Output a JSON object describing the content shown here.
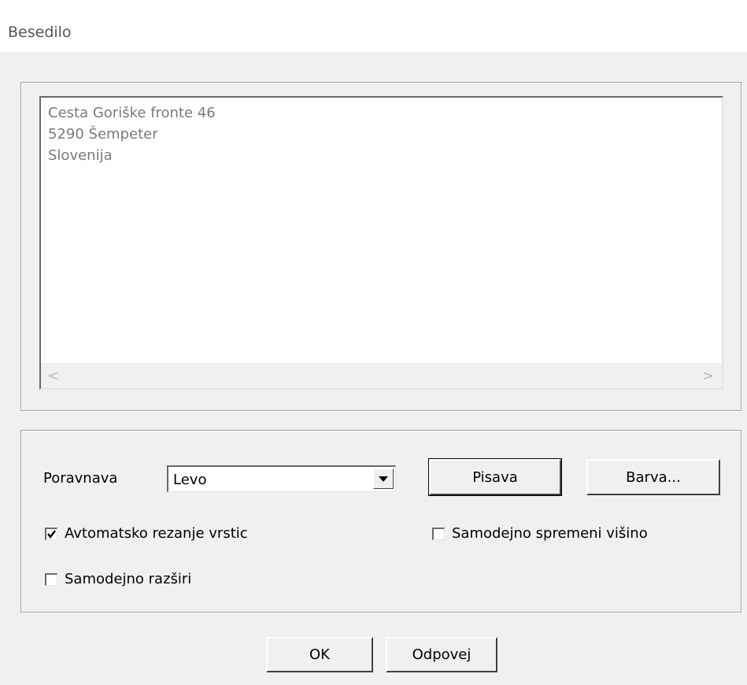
{
  "window": {
    "title": "Besedilo"
  },
  "text_area": {
    "lines": [
      "Cesta Goriške fronte 46",
      "5290 Šempeter",
      "Slovenija"
    ],
    "scroll_left": "<",
    "scroll_right": ">"
  },
  "options": {
    "alignment_label": "Poravnava",
    "alignment_value": "Levo",
    "font_button": "Pisava",
    "color_button": "Barva...",
    "auto_wrap": {
      "label": "Avtomatsko rezanje vrstic",
      "checked": true
    },
    "auto_height": {
      "label": "Samodejno spremeni višino",
      "checked": false
    },
    "auto_expand": {
      "label": "Samodejno razširi",
      "checked": false
    }
  },
  "footer": {
    "ok": "OK",
    "cancel": "Odpovej"
  }
}
